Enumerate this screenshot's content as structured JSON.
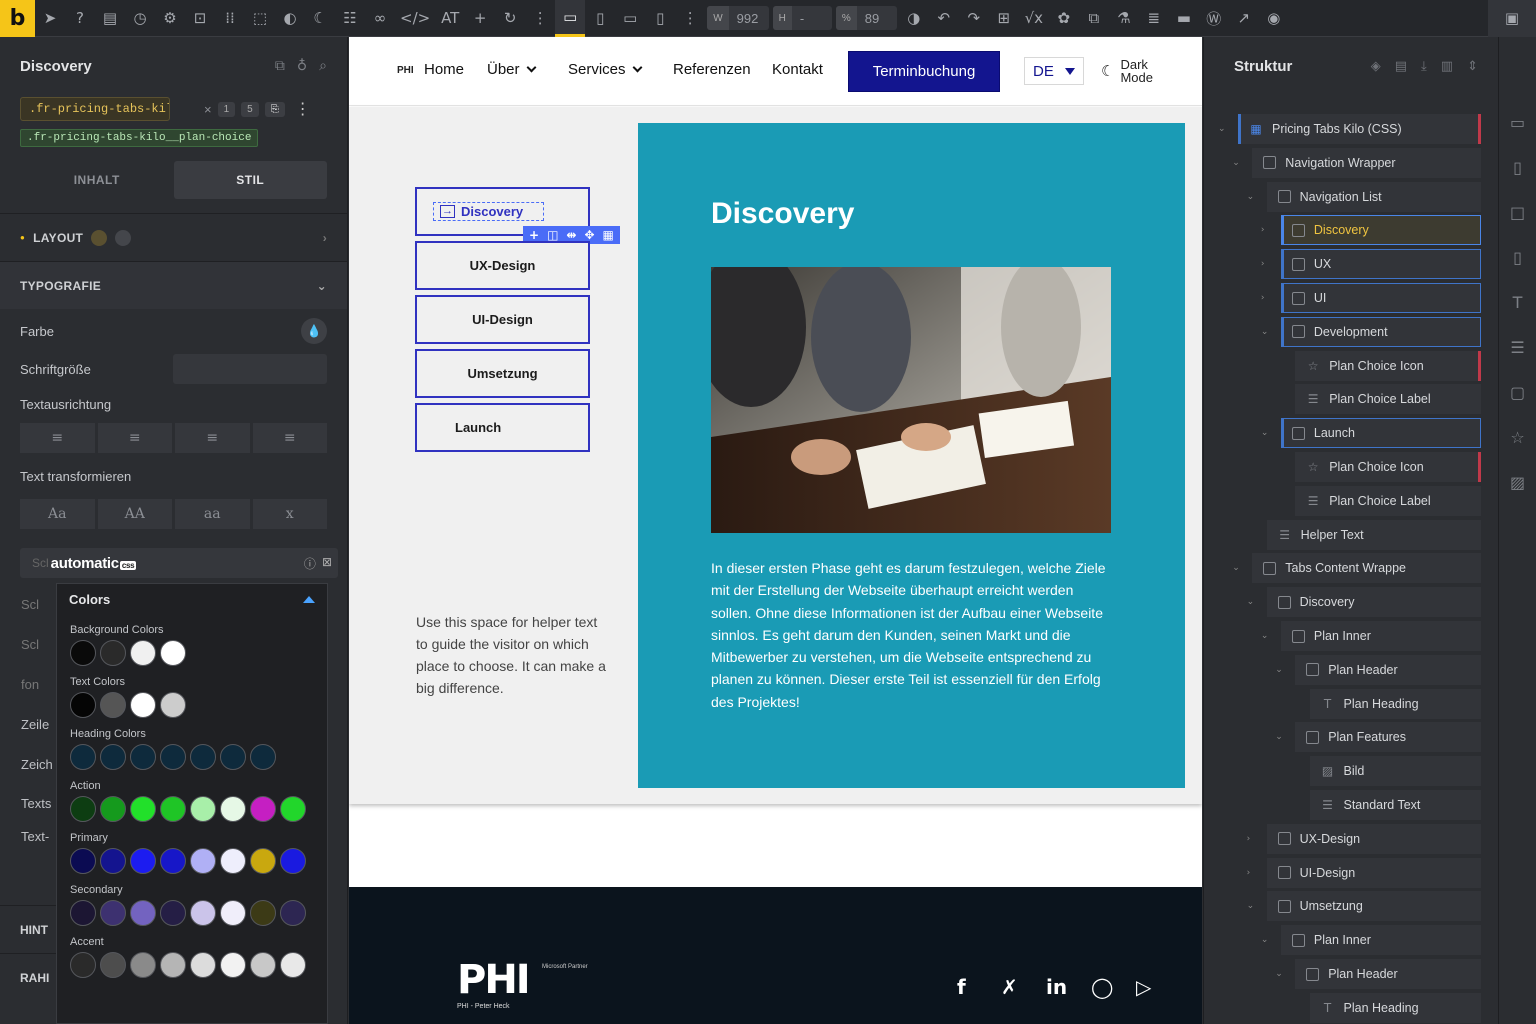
{
  "toolbar": {
    "logo": "b",
    "width_label": "W",
    "width_value": "992",
    "height_label": "H",
    "height_value": "-",
    "pct_label": "%",
    "pct_value": "89",
    "at_label": "AT"
  },
  "left_panel": {
    "title": "Discovery",
    "class_chip": ".fr-pricing-tabs-kil…",
    "class_badge_1": "1",
    "class_badge_2": "5",
    "class_sub": ".fr-pricing-tabs-kilo__plan-choice",
    "tab_content": "INHALT",
    "tab_style": "STIL",
    "section_layout": "LAYOUT",
    "section_typography": "TYPOGRAFIE",
    "prop_color": "Farbe",
    "prop_font_size": "Schriftgröße",
    "prop_text_align": "Textausrichtung",
    "prop_text_transform": "Text transformieren",
    "transform_options": [
      "Aa",
      "AA",
      "aa",
      "x"
    ],
    "side_labels": [
      "Scl",
      "Scl",
      "Scl",
      "fon",
      "Zeile",
      "Zeich",
      "Texts",
      "Text-"
    ],
    "bottom_sections": [
      "HINT",
      "RAHI"
    ]
  },
  "acss": {
    "brand": "automatic",
    "brand_badge": "css",
    "popup_title": "Colors",
    "groups": [
      {
        "label": "Background Colors",
        "colors": [
          "#0a0a0a",
          "#2a2a2a",
          "#f0f0f0",
          "#ffffff"
        ]
      },
      {
        "label": "Text Colors",
        "colors": [
          "#050505",
          "#555555",
          "#ffffff",
          "#cccccc"
        ]
      },
      {
        "label": "Heading Colors",
        "colors": [
          "#0e2a3c",
          "#0e2a3c",
          "#0e2a3c",
          "#0e2a3c",
          "#0e2a3c",
          "#0e2a3c",
          "#0e2a3c"
        ]
      },
      {
        "label": "Action",
        "colors": [
          "#0d3d12",
          "#159a1d",
          "#22e02a",
          "#1fc526",
          "#a8efa9",
          "#e6f8e6",
          "#c51fc2",
          "#22d62b"
        ]
      },
      {
        "label": "Primary",
        "colors": [
          "#0b0b52",
          "#14148f",
          "#1c1cf0",
          "#1717c8",
          "#b0b0f5",
          "#eeeefc",
          "#c9a80f",
          "#1a1ae0"
        ]
      },
      {
        "label": "Secondary",
        "colors": [
          "#1c1633",
          "#3d3170",
          "#7363c0",
          "#251e45",
          "#cbc4ea",
          "#f0eefa",
          "#3c3a16",
          "#2d2652"
        ]
      },
      {
        "label": "Accent",
        "colors": [
          "#2a2a2a",
          "#4d4d4d",
          "#8a8a8a",
          "#b5b5b5",
          "#dcdcdc",
          "#f2f2f2",
          "#c8c8c8",
          "#e8e8e8"
        ]
      }
    ]
  },
  "site": {
    "nav": {
      "logo_text": "PHI",
      "items": [
        "Home",
        "Über",
        "Services",
        "Referenzen",
        "Kontakt"
      ],
      "cta": "Terminbuchung",
      "lang": "DE",
      "dark_mode_1": "Dark",
      "dark_mode_2": "Mode"
    },
    "tabs": [
      "Discovery",
      "UX-Design",
      "UI-Design",
      "Umsetzung",
      "Launch"
    ],
    "helper_text": "Use this space for helper text to guide the visitor on which place to choose. It can make a big difference.",
    "content_heading": "Discovery",
    "content_text": "In dieser ersten Phase geht es darum festzulegen, welche Ziele mit der Erstellung der Webseite überhaupt erreicht werden sollen. Ohne diese Informationen ist der Aufbau einer Webseite sinnlos. Es geht darum den Kunden, seinen Markt und die Mitbewerber zu verstehen, um die Webseite entsprechend zu planen zu können. Dieser erste Teil ist essenziell für den Erfolg des Projektes!",
    "footer_logo": "PHI",
    "footer_logo_sub": "PHI - Peter Heck",
    "footer_partner": "Microsoft Partner",
    "social": [
      "f",
      "X",
      "in",
      "WhatsApp",
      "YouTube"
    ]
  },
  "structure": {
    "title": "Struktur",
    "nodes": [
      "Pricing Tabs Kilo (CSS)",
      "Navigation Wrapper",
      "Navigation List",
      "Discovery",
      "UX",
      "UI",
      "Development",
      "Plan Choice Icon",
      "Plan Choice Label",
      "Launch",
      "Plan Choice Icon",
      "Plan Choice Label",
      "Helper Text",
      "Tabs Content Wrappe",
      "Discovery",
      "Plan Inner",
      "Plan Header",
      "Plan Heading",
      "Plan Features",
      "Bild",
      "Standard Text",
      "UX-Design",
      "UI-Design",
      "Umsetzung",
      "Plan Inner",
      "Plan Header",
      "Plan Heading"
    ]
  }
}
